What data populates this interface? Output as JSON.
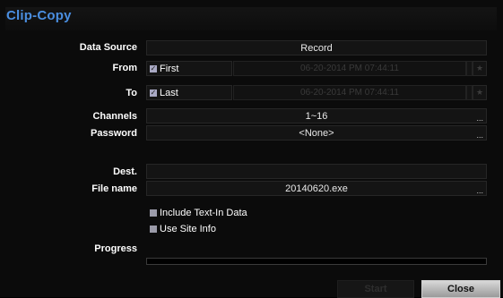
{
  "dialog": {
    "title": "Clip-Copy"
  },
  "form": {
    "data_source": {
      "label": "Data Source",
      "value": "Record"
    },
    "from": {
      "label": "From",
      "option": "First",
      "checked": true,
      "datetime": "06-20-2014 PM 07:44:11"
    },
    "to": {
      "label": "To",
      "option": "Last",
      "checked": true,
      "datetime": "06-20-2014 PM 07:44:11"
    },
    "channels": {
      "label": "Channels",
      "value": "1~16",
      "more": "..."
    },
    "password": {
      "label": "Password",
      "value": "<None>",
      "more": "..."
    },
    "dest": {
      "label": "Dest.",
      "value": ""
    },
    "file_name": {
      "label": "File name",
      "value": "20140620.exe",
      "more": "..."
    },
    "include_text_in": {
      "label": "Include Text-In Data",
      "checked": false
    },
    "use_site_info": {
      "label": "Use Site Info",
      "checked": false
    },
    "progress": {
      "label": "Progress",
      "value": 0
    }
  },
  "buttons": {
    "start": "Start",
    "close": "Close"
  },
  "icons": {
    "calendar": "calendar-icon",
    "check": "check-icon"
  },
  "colors": {
    "title": "#4a8ee0",
    "background": "#0b0b0b"
  }
}
